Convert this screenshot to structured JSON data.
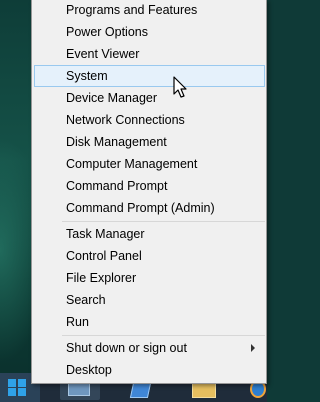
{
  "menu": {
    "group1": [
      "Programs and Features",
      "Power Options",
      "Event Viewer",
      "System",
      "Device Manager",
      "Network Connections",
      "Disk Management",
      "Computer Management",
      "Command Prompt",
      "Command Prompt (Admin)"
    ],
    "group2": [
      "Task Manager",
      "Control Panel",
      "File Explorer",
      "Search",
      "Run"
    ],
    "group3": [
      "Shut down or sign out",
      "Desktop"
    ],
    "selected": "System"
  },
  "icons": {
    "start": "windows-logo-icon",
    "submenu": "chevron-right-icon",
    "cursor": "mouse-pointer-icon"
  },
  "colors": {
    "menu_bg": "#f0f0f0",
    "highlight_bg": "#e5f1fb",
    "highlight_border": "#99c9ef",
    "taskbar": "#1f2c3a",
    "start_logo": "#2fa2e8"
  }
}
